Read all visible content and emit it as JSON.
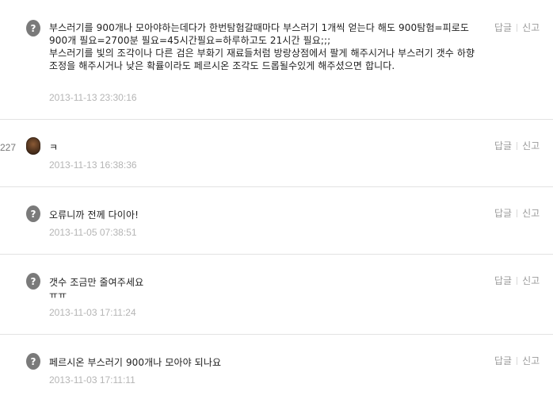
{
  "actions": {
    "reply_label": "답글",
    "report_label": "신고"
  },
  "edge_number": "227",
  "comments": [
    {
      "text": "부스러기를 900개나 모아야하는데다가 한번탐험갈때마다 부스러기 1개씩 얻는다 해도 900탐험=피로도 900개 필요=2700분 필요=45시간필요=하루하고도 21시간 필요;;;\n부스러기를 빛의 조각이나 다른 검은 부화기 재료들처럼 방랑상점에서 팔게 해주시거나 부스러기 갯수 하향조정을 해주시거나 낮은 확률이라도 페르시온 조각도 드롭될수있게 해주셨으면 합니다.",
      "date": "2013-11-13 23:30:16",
      "avatar": "default-egg-icon"
    },
    {
      "text": "ㅋ",
      "date": "2013-11-13 16:38:36",
      "avatar": "user-photo"
    },
    {
      "text": "오류니까 전께 다이아!",
      "date": "2013-11-05 07:38:51",
      "avatar": "default-egg-icon"
    },
    {
      "text": "갯수 조금만 줄여주세요\nㅠㅠ",
      "date": "2013-11-03 17:11:24",
      "avatar": "default-egg-icon"
    },
    {
      "text": "페르시온 부스러기 900개나 모아야 되나요",
      "date": "2013-11-03 17:11:11",
      "avatar": "default-egg-icon"
    }
  ]
}
